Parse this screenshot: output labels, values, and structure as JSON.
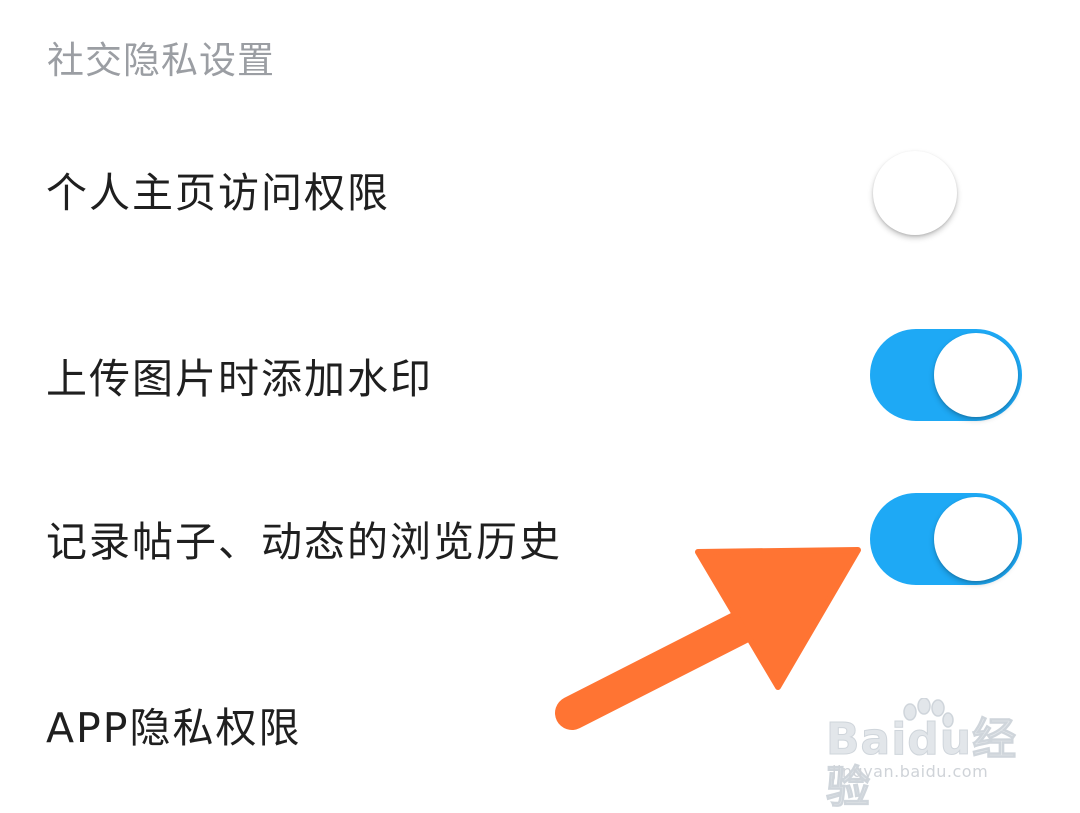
{
  "section_title": "社交隐私设置",
  "settings": [
    {
      "label": "个人主页访问权限",
      "toggle_on": false
    },
    {
      "label": "上传图片时添加水印",
      "toggle_on": true
    },
    {
      "label": "记录帖子、动态的浏览历史",
      "toggle_on": true
    },
    {
      "label": "APP隐私权限"
    }
  ],
  "colors": {
    "toggle_on": "#1ea9f5",
    "arrow": "#ff7433",
    "section_title": "#9b9ea3",
    "label": "#1f1f1f"
  },
  "watermark": {
    "brand": "Baidu经验",
    "url": "jingyan.baidu.com"
  }
}
